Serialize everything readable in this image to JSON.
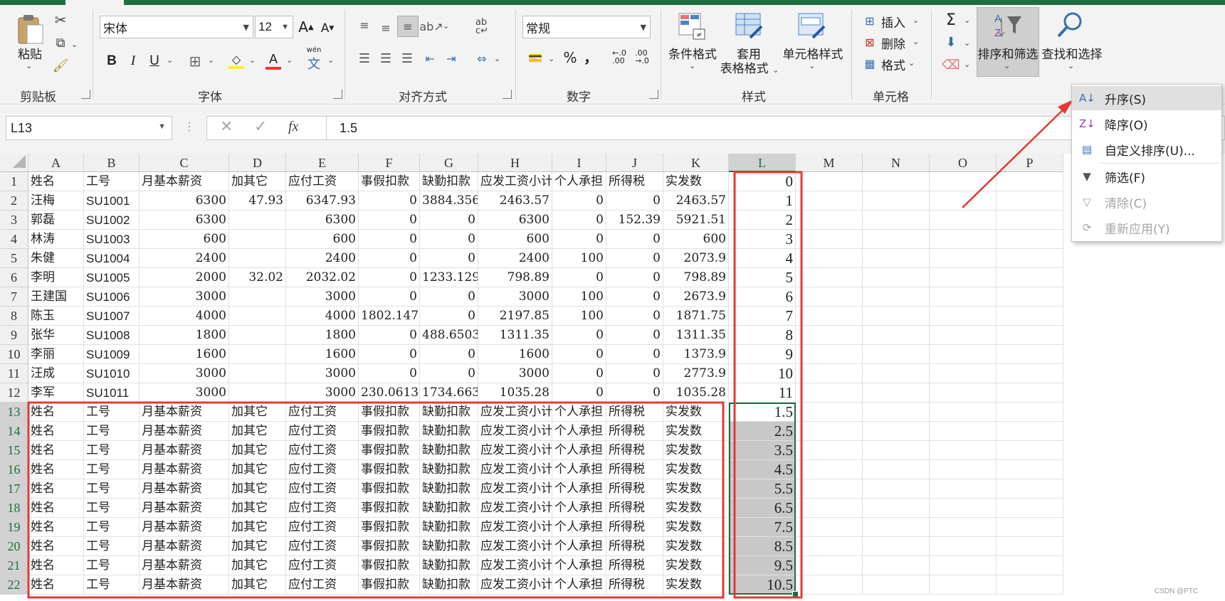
{
  "ribbon": {
    "clipboard": {
      "paste": "粘贴",
      "group": "剪贴板"
    },
    "font": {
      "name": "宋体",
      "size": "12",
      "group": "字体",
      "bold": "B",
      "italic": "I",
      "underline": "U",
      "phonetic": "wén",
      "phonetic_char": "文"
    },
    "alignment": {
      "group": "对齐方式"
    },
    "number": {
      "format": "常规",
      "group": "数字",
      "percent": "%",
      "comma": "，"
    },
    "styles": {
      "conditional": "条件格式",
      "table_line1": "套用",
      "table_line2": "表格格式",
      "cell_styles": "单元格样式",
      "group": "样式"
    },
    "cells": {
      "insert": "插入",
      "delete": "删除",
      "format": "格式",
      "group": "单元格"
    },
    "editing": {
      "sort_filter": "排序和筛选",
      "find_select": "查找和选择"
    }
  },
  "formula_bar": {
    "name_box": "L13",
    "formula": "1.5",
    "fx": "fx"
  },
  "sheet": {
    "columns": [
      "A",
      "B",
      "C",
      "D",
      "E",
      "F",
      "G",
      "H",
      "I",
      "J",
      "K",
      "L",
      "M",
      "N",
      "O",
      "P"
    ],
    "rows": [
      [
        "姓名",
        "工号",
        "月基本薪资",
        "加其它",
        "应付工资",
        "事假扣款",
        "缺勤扣款",
        "应发工资小计",
        "个人承担",
        "所得税",
        "实发数",
        "0"
      ],
      [
        "汪梅",
        "SU1001",
        "6300",
        "47.93",
        "6347.93",
        "0",
        "3884.356",
        "2463.57",
        "0",
        "0",
        "2463.57",
        "1"
      ],
      [
        "郭磊",
        "SU1002",
        "6300",
        "",
        "6300",
        "0",
        "0",
        "6300",
        "0",
        "152.39",
        "5921.51",
        "2"
      ],
      [
        "林涛",
        "SU1003",
        "600",
        "",
        "600",
        "0",
        "0",
        "600",
        "0",
        "0",
        "600",
        "3"
      ],
      [
        "朱健",
        "SU1004",
        "2400",
        "",
        "2400",
        "0",
        "0",
        "2400",
        "100",
        "0",
        "2073.9",
        "4"
      ],
      [
        "李明",
        "SU1005",
        "2000",
        "32.02",
        "2032.02",
        "0",
        "1233.129",
        "798.89",
        "0",
        "0",
        "798.89",
        "5"
      ],
      [
        "王建国",
        "SU1006",
        "3000",
        "",
        "3000",
        "0",
        "0",
        "3000",
        "100",
        "0",
        "2673.9",
        "6"
      ],
      [
        "陈玉",
        "SU1007",
        "4000",
        "",
        "4000",
        "1802.147",
        "0",
        "2197.85",
        "100",
        "0",
        "1871.75",
        "7"
      ],
      [
        "张华",
        "SU1008",
        "1800",
        "",
        "1800",
        "0",
        "488.6503",
        "1311.35",
        "0",
        "0",
        "1311.35",
        "8"
      ],
      [
        "李丽",
        "SU1009",
        "1600",
        "",
        "1600",
        "0",
        "0",
        "1600",
        "0",
        "0",
        "1373.9",
        "9"
      ],
      [
        "汪成",
        "SU1010",
        "3000",
        "",
        "3000",
        "0",
        "0",
        "3000",
        "0",
        "0",
        "2773.9",
        "10"
      ],
      [
        "李军",
        "SU1011",
        "3000",
        "",
        "3000",
        "230.0613",
        "1734.663",
        "1035.28",
        "0",
        "0",
        "1035.28",
        "11"
      ],
      [
        "姓名",
        "工号",
        "月基本薪资",
        "加其它",
        "应付工资",
        "事假扣款",
        "缺勤扣款",
        "应发工资小计",
        "个人承担",
        "所得税",
        "实发数",
        "1.5"
      ],
      [
        "姓名",
        "工号",
        "月基本薪资",
        "加其它",
        "应付工资",
        "事假扣款",
        "缺勤扣款",
        "应发工资小计",
        "个人承担",
        "所得税",
        "实发数",
        "2.5"
      ],
      [
        "姓名",
        "工号",
        "月基本薪资",
        "加其它",
        "应付工资",
        "事假扣款",
        "缺勤扣款",
        "应发工资小计",
        "个人承担",
        "所得税",
        "实发数",
        "3.5"
      ],
      [
        "姓名",
        "工号",
        "月基本薪资",
        "加其它",
        "应付工资",
        "事假扣款",
        "缺勤扣款",
        "应发工资小计",
        "个人承担",
        "所得税",
        "实发数",
        "4.5"
      ],
      [
        "姓名",
        "工号",
        "月基本薪资",
        "加其它",
        "应付工资",
        "事假扣款",
        "缺勤扣款",
        "应发工资小计",
        "个人承担",
        "所得税",
        "实发数",
        "5.5"
      ],
      [
        "姓名",
        "工号",
        "月基本薪资",
        "加其它",
        "应付工资",
        "事假扣款",
        "缺勤扣款",
        "应发工资小计",
        "个人承担",
        "所得税",
        "实发数",
        "6.5"
      ],
      [
        "姓名",
        "工号",
        "月基本薪资",
        "加其它",
        "应付工资",
        "事假扣款",
        "缺勤扣款",
        "应发工资小计",
        "个人承担",
        "所得税",
        "实发数",
        "7.5"
      ],
      [
        "姓名",
        "工号",
        "月基本薪资",
        "加其它",
        "应付工资",
        "事假扣款",
        "缺勤扣款",
        "应发工资小计",
        "个人承担",
        "所得税",
        "实发数",
        "8.5"
      ],
      [
        "姓名",
        "工号",
        "月基本薪资",
        "加其它",
        "应付工资",
        "事假扣款",
        "缺勤扣款",
        "应发工资小计",
        "个人承担",
        "所得税",
        "实发数",
        "9.5"
      ],
      [
        "姓名",
        "工号",
        "月基本薪资",
        "加其它",
        "应付工资",
        "事假扣款",
        "缺勤扣款",
        "应发工资小计",
        "个人承担",
        "所得税",
        "实发数",
        "10.5"
      ]
    ]
  },
  "sort_menu": {
    "items": [
      {
        "label": "升序(S)",
        "icon": "sort-ascending-icon",
        "enabled": true
      },
      {
        "label": "降序(O)",
        "icon": "sort-descending-icon",
        "enabled": true
      },
      {
        "label": "自定义排序(U)...",
        "icon": "custom-sort-icon",
        "enabled": true
      },
      {
        "label": "筛选(F)",
        "icon": "filter-icon",
        "enabled": true
      },
      {
        "label": "清除(C)",
        "icon": "clear-filter-icon",
        "enabled": false
      },
      {
        "label": "重新应用(Y)",
        "icon": "reapply-filter-icon",
        "enabled": false
      }
    ]
  },
  "watermark": "CSDN @PTC",
  "colors": {
    "accent": "#1e6e42",
    "annotation": "#e53935",
    "selection_fill": "#c8c8c8"
  }
}
